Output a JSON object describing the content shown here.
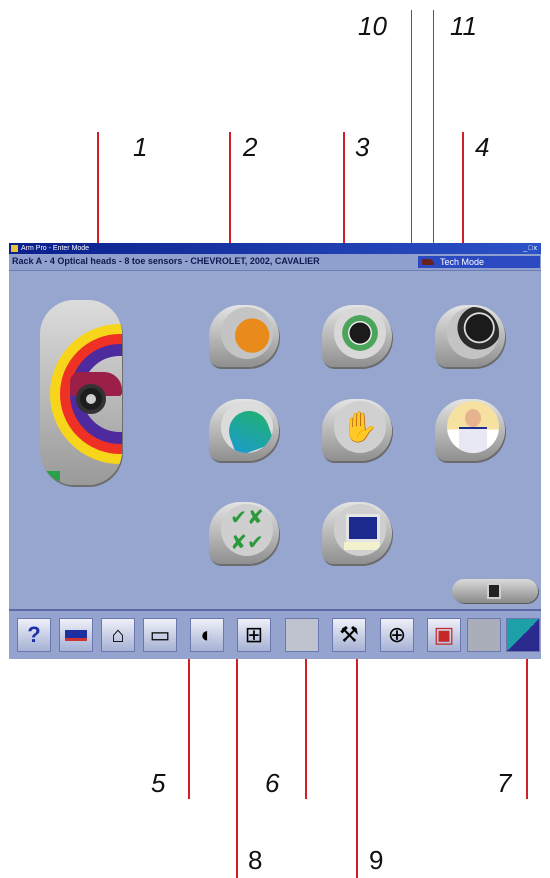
{
  "callouts": {
    "n1": "1",
    "n2": "2",
    "n3": "3",
    "n4": "4",
    "n5": "5",
    "n6": "6",
    "n7": "7",
    "n8": "8",
    "n9": "9",
    "n10": "10",
    "n11": "11"
  },
  "window": {
    "title": "Arm Pro - Enter Mode",
    "window_buttons": "_□x",
    "rack_text": "Rack A - 4 Optical heads - 8 toe sensors - CHEVROLET, 2002, CAVALIER",
    "mode_label": "Tech Mode"
  },
  "main_buttons": [
    {
      "name": "vehicle-selection-button",
      "icon": "car-icon"
    },
    {
      "name": "tire-button",
      "icon": "tire-icon"
    },
    {
      "name": "manufacturer-info-button",
      "icon": "wheel-icon"
    },
    {
      "name": "measure-button",
      "icon": "gauge-icon"
    },
    {
      "name": "adjust-button",
      "icon": "hand-icon"
    },
    {
      "name": "operator-button",
      "icon": "person-icon"
    },
    {
      "name": "checklist-button",
      "icon": "checkmarks-icon"
    },
    {
      "name": "computer-button",
      "icon": "monitor-icon"
    }
  ],
  "toolbar": {
    "help_glyph": "?",
    "items": [
      "help-icon",
      "rack-icon",
      "home-icon",
      "printer-icon",
      "moon-icon",
      "network-icon",
      "blank-icon",
      "tools-icon",
      "target-icon",
      "battery-icon",
      "blank2-icon",
      "chart-icon"
    ]
  }
}
